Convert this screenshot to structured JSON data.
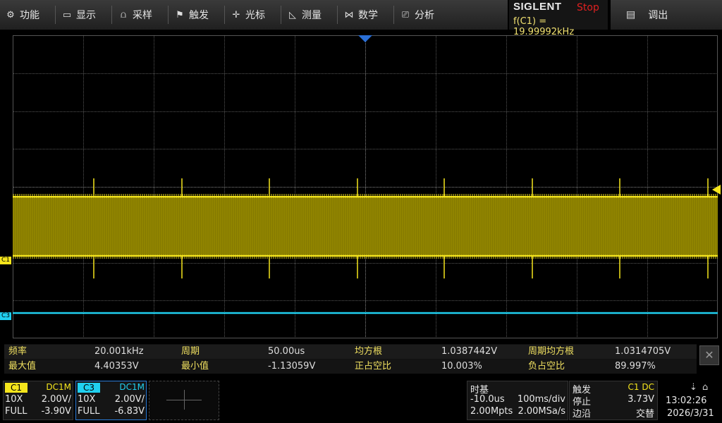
{
  "menu": {
    "items": [
      {
        "label": "功能",
        "icon": "gear-icon",
        "glyph": "⚙"
      },
      {
        "label": "显示",
        "icon": "monitor-icon",
        "glyph": "▭"
      },
      {
        "label": "采样",
        "icon": "sample-icon",
        "glyph": "⩍"
      },
      {
        "label": "触发",
        "icon": "trigger-flag-icon",
        "glyph": "⚑"
      },
      {
        "label": "光标",
        "icon": "cursor-icon",
        "glyph": "✛"
      },
      {
        "label": "测量",
        "icon": "measure-icon",
        "glyph": "◺"
      },
      {
        "label": "数学",
        "icon": "math-icon",
        "glyph": "⋈"
      },
      {
        "label": "分析",
        "icon": "analysis-icon",
        "glyph": "⎚"
      }
    ]
  },
  "brand": {
    "name": "SIGLENT",
    "status": "Stop",
    "frequency": "f(C1) = 19.99992kHz"
  },
  "callout": {
    "label": "调出",
    "icon": "document-icon"
  },
  "markers": {
    "c1": "C1",
    "c3": "C3"
  },
  "measurements": {
    "row1": [
      {
        "label": "频率",
        "value": "20.001kHz"
      },
      {
        "label": "周期",
        "value": "50.00us"
      },
      {
        "label": "均方根",
        "value": "1.0387442V"
      },
      {
        "label": "周期均方根",
        "value": "1.0314705V"
      }
    ],
    "row2": [
      {
        "label": "最大值",
        "value": "4.40353V"
      },
      {
        "label": "最小值",
        "value": "-1.13059V"
      },
      {
        "label": "正占空比",
        "value": "10.003%"
      },
      {
        "label": "负占空比",
        "value": "89.997%"
      }
    ]
  },
  "channels": {
    "c1": {
      "name": "C1",
      "coupling": "DC1M",
      "probe": "10X",
      "scale": "2.00V/",
      "bw": "FULL",
      "offset": "-3.90V",
      "color": "#f5e51c"
    },
    "c3": {
      "name": "C3",
      "coupling": "DC1M",
      "probe": "10X",
      "scale": "2.00V/",
      "bw": "FULL",
      "offset": "-6.83V",
      "color": "#20d0f0"
    }
  },
  "timebase": {
    "title": "时基",
    "delay": "-10.0us",
    "scale": "100ms/div",
    "memory": "2.00Mpts",
    "rate": "2.00MSa/s"
  },
  "trigger": {
    "title": "触发",
    "source": "C1 DC",
    "mode": "停止",
    "level": "3.73V",
    "type": "边沿",
    "slope": "交替"
  },
  "system": {
    "time": "13:02:26",
    "date": "2026/3/31"
  },
  "colors": {
    "ch1": "#f5e51c",
    "ch1_fill": "#8a7f00",
    "ch3": "#20d0f0",
    "trigger_marker": "#2a6fd6"
  }
}
